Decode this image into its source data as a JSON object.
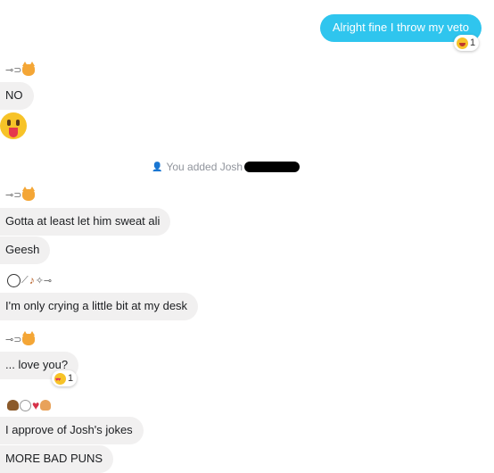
{
  "outgoing": {
    "text": "Alright fine I throw my veto",
    "reaction_count": "1"
  },
  "groups": [
    {
      "messages": [
        "NO"
      ]
    },
    {
      "messages": [
        "Gotta at least let him sweat ali",
        "Geesh"
      ]
    },
    {
      "messages": [
        "I'm only crying a little bit at my desk"
      ]
    },
    {
      "messages": [
        "... love you?"
      ],
      "reaction_count": "1"
    },
    {
      "messages": [
        "I approve of Josh's jokes",
        "MORE BAD PUNS"
      ]
    }
  ],
  "system_message": {
    "text": "You added Josh"
  },
  "colors": {
    "outgoing_bubble": "#2fc5ee",
    "incoming_bubble": "#f1f0f0",
    "system_text": "#90949c"
  },
  "icons": [
    "laughing-reaction-icon",
    "tongue-out-emoji",
    "cat-emoji",
    "heart-eyes-reaction-icon",
    "poop-emoji",
    "broken-heart-emoji",
    "soccer-ball-emoji",
    "violin-emoji",
    "person-add-icon"
  ]
}
